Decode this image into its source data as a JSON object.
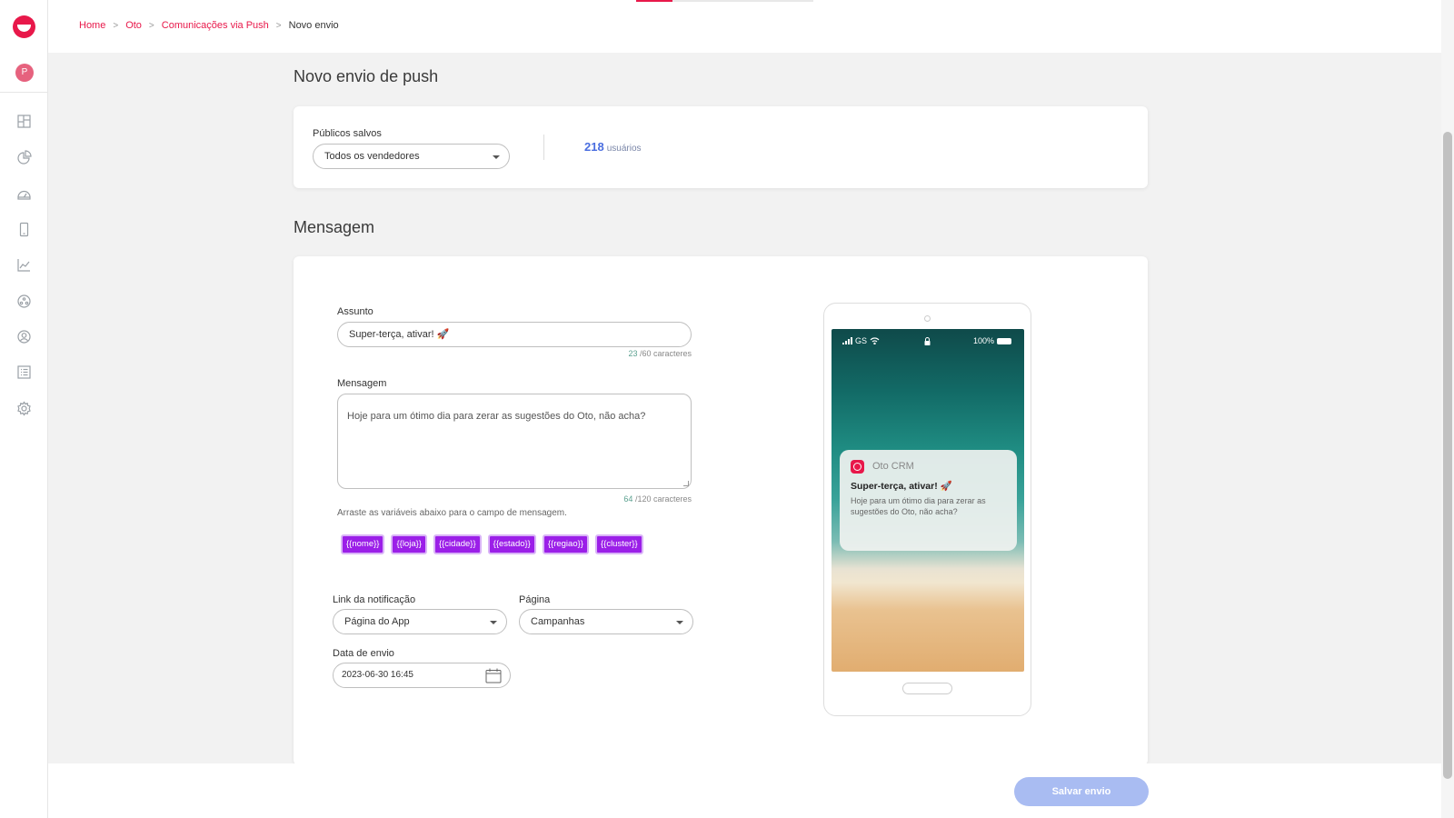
{
  "app": {
    "brand_color": "#e8184a",
    "avatar_initial": "P"
  },
  "sidebar": {
    "items": [
      {
        "icon": "dashboard-icon"
      },
      {
        "icon": "pie-chart-icon"
      },
      {
        "icon": "gauge-icon"
      },
      {
        "icon": "smartphone-icon"
      },
      {
        "icon": "line-chart-icon"
      },
      {
        "icon": "network-icon"
      },
      {
        "icon": "user-circle-icon"
      },
      {
        "icon": "list-icon"
      },
      {
        "icon": "gear-icon"
      }
    ]
  },
  "breadcrumb": {
    "items": [
      "Home",
      "Oto",
      "Comunicações via Push"
    ],
    "current": "Novo envio",
    "separator": ">"
  },
  "audience_section": {
    "title": "Novo envio de push",
    "saved_audiences_label": "Públicos salvos",
    "saved_audience_value": "Todos os vendedores",
    "user_count": "218",
    "user_count_unit": "usuários"
  },
  "message_section": {
    "title": "Mensagem",
    "subject_label": "Assunto",
    "subject_value": "Super-terça, ativar! 🚀",
    "subject_count": "23",
    "subject_limit": "/60 caracteres",
    "message_label": "Mensagem",
    "message_value": "Hoje para um ótimo dia para zerar as sugestões do Oto, não acha?",
    "message_count": "64",
    "message_limit": "/120 caracteres",
    "variables_hint": "Arraste as variáveis abaixo para o campo de mensagem.",
    "variables": [
      "{{nome}}",
      "{{loja}}",
      "{{cidade}}",
      "{{estado}}",
      "{{regiao}}",
      "{{cluster}}"
    ],
    "link_label": "Link da notificação",
    "link_value": "Página do App",
    "page_label": "Página",
    "page_value": "Campanhas",
    "date_label": "Data de envio",
    "date_value": "2023-06-30 16:45"
  },
  "preview": {
    "carrier": "GS",
    "battery": "100%",
    "app_name": "Oto CRM",
    "title": "Super-terça, ativar! 🚀",
    "body": "Hoje para um ótimo dia para zerar as sugestões do Oto, não acha?"
  },
  "footer": {
    "save_label": "Salvar envio"
  }
}
